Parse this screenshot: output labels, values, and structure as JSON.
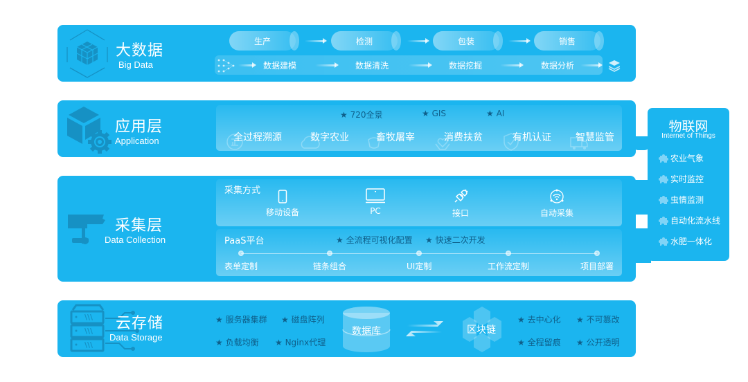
{
  "colors": {
    "panel": "#1bb5ef",
    "star_text": "#0f5f8a",
    "text": "#ffffff",
    "background": "#ffffff"
  },
  "big_data": {
    "title_cn": "大数据",
    "title_en": "Big Data",
    "pipes": [
      "生产",
      "检测",
      "包装",
      "销售"
    ],
    "flow": [
      "数据建模",
      "数据清洗",
      "数据挖掘",
      "数据分析"
    ],
    "icon": "cube-grid-icon",
    "end_icon": "layers-icon"
  },
  "application": {
    "title_cn": "应用层",
    "title_en": "Application",
    "icon": "box-gear-icon",
    "features": [
      "★ 720全景",
      "★ GIS",
      "★ AI"
    ],
    "items": [
      "全过程溯源",
      "数字农业",
      "畜牧屠宰",
      "消费扶贫",
      "有机认证",
      "智慧监管"
    ]
  },
  "collection": {
    "title_cn": "采集层",
    "title_en": "Data Collection",
    "icon": "camera-icon",
    "methods_label": "采集方式",
    "methods": [
      {
        "label": "移动设备",
        "icon": "mobile-icon"
      },
      {
        "label": "PC",
        "icon": "laptop-icon"
      },
      {
        "label": "接口",
        "icon": "plug-icon"
      },
      {
        "label": "自动采集",
        "icon": "wifi-sensor-icon"
      }
    ],
    "paas_label": "PaaS平台",
    "paas_features": [
      "★ 全流程可视化配置",
      "★ 快速二次开发"
    ],
    "steps": [
      "表单定制",
      "链条组合",
      "UI定制",
      "工作流定制",
      "项目部署"
    ]
  },
  "storage": {
    "title_cn": "云存储",
    "title_en": "Data Storage",
    "icon": "server-rack-icon",
    "left_features": [
      "★ 服务器集群",
      "★ 磁盘阵列",
      "★ 负载均衡",
      "★ Nginx代理"
    ],
    "database_label": "数据库",
    "blockchain_label": "区块链",
    "right_features": [
      "★ 去中心化",
      "★ 不可篡改",
      "★ 全程留痕",
      "★ 公开透明"
    ]
  },
  "iot": {
    "title_cn": "物联网",
    "title_en": "Internet of Things",
    "items": [
      "农业气象",
      "实时监控",
      "虫情监测",
      "自动化流水线",
      "水肥一体化"
    ]
  }
}
